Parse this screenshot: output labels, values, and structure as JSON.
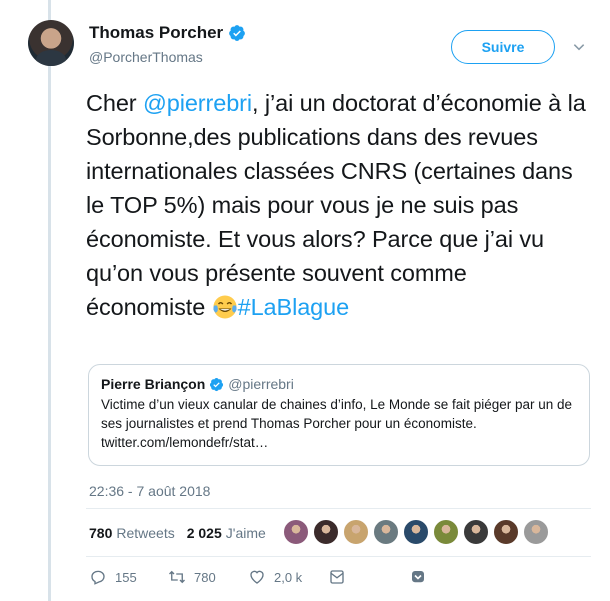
{
  "author": {
    "name": "Thomas Porcher",
    "handle": "@PorcherThomas"
  },
  "follow_button": "Suivre",
  "tweet": {
    "part1": "Cher ",
    "mention": "@pierrebri",
    "part2": ", j’ai un doctorat d’économie à la Sorbonne,des publications dans des revues internationales classées CNRS (certaines dans le TOP 5%) mais pour vous je ne suis pas économiste. Et vous alors? Parce que j’ai vu qu’on vous présente souvent comme économiste ",
    "hashtag": "#LaBlague"
  },
  "quoted": {
    "name": "Pierre Briançon",
    "handle": "@pierrebri",
    "text": "Victime d’un vieux canular de chaines d’info, Le Monde se fait piéger par un de ses journalistes et prend Thomas Porcher pour un économiste.",
    "link": "twitter.com/lemondefr/stat…"
  },
  "timestamp": "22:36 - 7 août 2018",
  "stats": {
    "retweets_count": "780",
    "retweets_label": "Retweets",
    "likes_count": "2 025",
    "likes_label": "J'aime"
  },
  "likers_colors": [
    "#8b5a7a",
    "#3b2b2b",
    "#c8a46e",
    "#6a7a80",
    "#2a4a6a",
    "#7a8a3a",
    "#3a3a3a",
    "#5a3a2a",
    "#9a9a9a"
  ],
  "actions": {
    "reply_count": "155",
    "retweet_count": "780",
    "like_count": "2,0 k"
  },
  "colors": {
    "accent": "#1da1f2",
    "muted": "#657786"
  }
}
